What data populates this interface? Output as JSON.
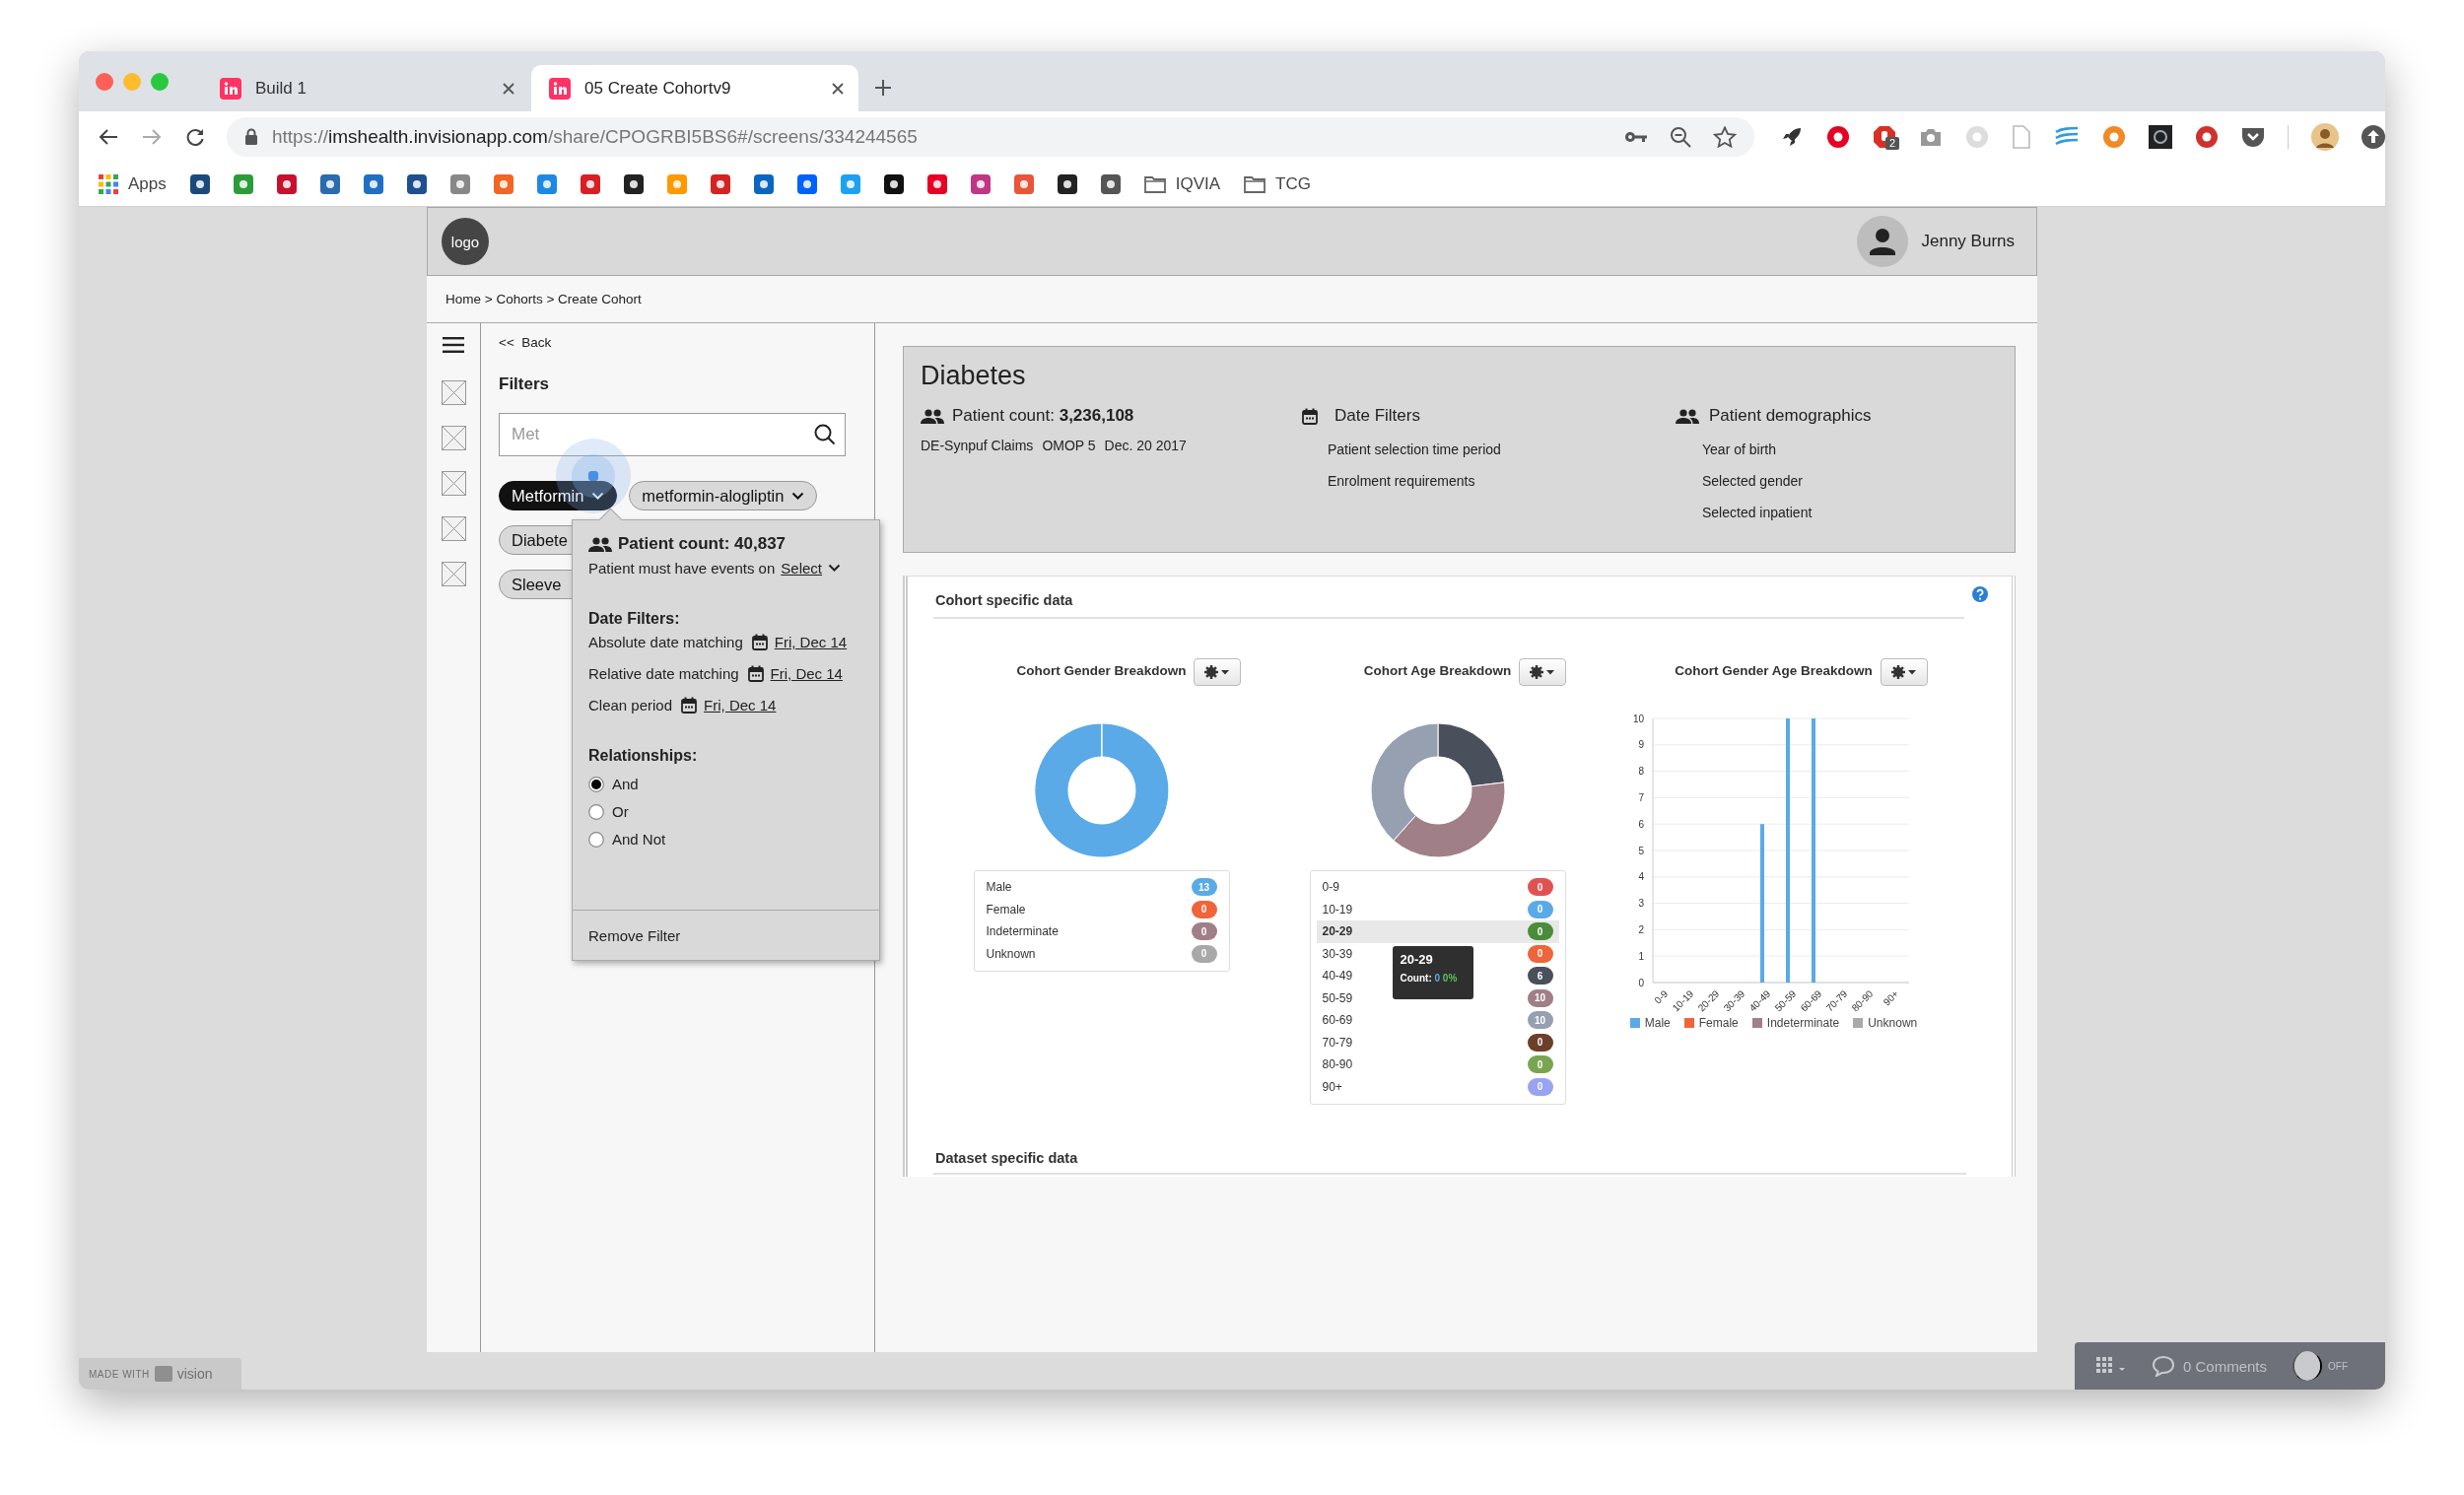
{
  "browser": {
    "tabs": [
      {
        "title": "Build 1",
        "selected": false
      },
      {
        "title": "05 Create Cohortv9",
        "selected": true
      }
    ],
    "url": {
      "scheme": "https://",
      "host": "imshealth.invisionapp.com",
      "path": "/share/CPOGRBI5BS6#/screens/334244565"
    },
    "extension_badge": "2",
    "bookmarks": [
      {
        "kind": "apps",
        "label": "Apps"
      },
      {
        "kind": "folder",
        "label": "IQVIA"
      },
      {
        "kind": "folder",
        "label": "TCG"
      }
    ]
  },
  "app": {
    "logo": "logo",
    "user": "Jenny Burns",
    "breadcrumb": "Home > Cohorts > Create Cohort"
  },
  "filters": {
    "back": "<<  Back",
    "title": "Filters",
    "search": {
      "placeholder": "Met"
    },
    "chip_rows": [
      [
        {
          "label": "Metformin",
          "selected": true,
          "caret": true
        },
        {
          "label": "metformin-alogliptin",
          "selected": false,
          "caret": true
        }
      ],
      [
        {
          "label": "Diabete",
          "selected": false,
          "caret": false
        }
      ],
      [
        {
          "label": "Sleeve",
          "selected": false,
          "caret": false
        }
      ]
    ],
    "popover": {
      "count": "Patient count: 40,837",
      "events_label": "Patient must have events on",
      "events_select": "Select",
      "date_title": "Date Filters:",
      "dates": [
        {
          "label": "Absolute date matching",
          "date": "Fri, Dec 14"
        },
        {
          "label": "Relative date matching",
          "date": "Fri, Dec 14"
        },
        {
          "label": "Clean period",
          "date": "Fri, Dec 14"
        }
      ],
      "relationships_title": "Relationships:",
      "relationships": [
        {
          "label": "And",
          "selected": true
        },
        {
          "label": "Or",
          "selected": false
        },
        {
          "label": "And Not",
          "selected": false
        }
      ],
      "remove": "Remove Filter"
    }
  },
  "summary": {
    "title": "Diabetes",
    "count": "Patient count: **3,236,108**",
    "sources": [
      "DE-Synpuf Claims",
      "OMOP 5",
      "Dec. 20 2017"
    ],
    "date_filters": {
      "title": "Date Filters",
      "items": [
        "Patient selection time period",
        "Enrolment requirements"
      ]
    },
    "demographics": {
      "title": "Patient demographics",
      "items": [
        "Year of birth",
        "Selected gender",
        "Selected inpatient"
      ]
    }
  },
  "cohort": {
    "title": "Cohort specific data",
    "dataset_title": "Dataset specific data",
    "charts": [
      {
        "chart_data": {
          "type": "donut",
          "title": "Cohort Gender Breakdown",
          "categories": [
            "Male",
            "Female",
            "Indeterminate",
            "Unknown"
          ],
          "values": [
            100,
            0,
            0,
            0
          ]
        },
        "legend": [
          {
            "count": "13",
            "color": "#5aaae8",
            "selected": false
          },
          {
            "count": "0",
            "color": "#f0643a",
            "selected": false
          },
          {
            "count": "0",
            "color": "#a07f88",
            "selected": false
          },
          {
            "count": "0",
            "color": "#a9a9a9",
            "selected": false
          }
        ]
      },
      {
        "chart_data": {
          "type": "donut",
          "title": "Cohort Age Breakdown",
          "categories": [
            "0-9",
            "10-19",
            "20-29",
            "30-39",
            "40-49",
            "50-59",
            "60-69",
            "70-79",
            "80-90",
            "90+"
          ],
          "values": [
            0,
            0,
            0,
            0,
            23.08,
            38.46,
            38.46,
            0,
            0,
            0
          ]
        },
        "legend": [
          {
            "count": "0",
            "color": "#e05252",
            "selected": false
          },
          {
            "count": "0",
            "color": "#5aaae8",
            "selected": false
          },
          {
            "count": "0",
            "color": "#4a8c3a",
            "selected": true
          },
          {
            "count": "0",
            "color": "#f0643a",
            "selected": false
          },
          {
            "count": "6",
            "color": "#4a4f5c",
            "selected": false
          },
          {
            "count": "10",
            "color": "#a07f88",
            "selected": false
          },
          {
            "count": "10",
            "color": "#97a0b0",
            "selected": false
          },
          {
            "count": "0",
            "color": "#6b3f2a",
            "selected": false
          },
          {
            "count": "0",
            "color": "#7aa550",
            "selected": false
          },
          {
            "count": "0",
            "color": "#9aa3f0",
            "selected": false
          }
        ],
        "tooltip": {
          "title": "20-29",
          "count_label": "Count:",
          "count": "0",
          "percent": "0%"
        }
      },
      {
        "chart_data": {
          "type": "bar",
          "grid": true,
          "title": "Cohort Gender Age Breakdown",
          "categories": [
            "0-9",
            "10-19",
            "20-29",
            "30-39",
            "40-49",
            "50-59",
            "60-69",
            "70-79",
            "80-90",
            "90+"
          ],
          "series": [
            {
              "name": "Male",
              "color": "#5aaae8",
              "values": [
                0,
                0,
                0,
                0,
                6,
                10,
                10,
                0,
                0,
                0
              ]
            },
            {
              "name": "Female",
              "color": "#f0643a",
              "values": [
                0,
                0,
                0,
                0,
                0,
                0,
                0,
                0,
                0,
                0
              ]
            },
            {
              "name": "Indeterminate",
              "color": "#a07f88",
              "values": [
                0,
                0,
                0,
                0,
                0,
                0,
                0,
                0,
                0,
                0
              ]
            },
            {
              "name": "Unknown",
              "color": "#a9a9a9",
              "values": [
                0,
                0,
                0,
                0,
                0,
                0,
                0,
                0,
                0,
                0
              ]
            }
          ],
          "ylim": [
            0,
            10
          ],
          "yticks": [
            0,
            1,
            2,
            3,
            4,
            5,
            6,
            7,
            8,
            9,
            10
          ]
        }
      }
    ]
  },
  "invision": {
    "made_with": "MADE WITH",
    "brand": "vision",
    "comments": "0 Comments",
    "toggle": {
      "label": "OFF",
      "on": false
    }
  }
}
